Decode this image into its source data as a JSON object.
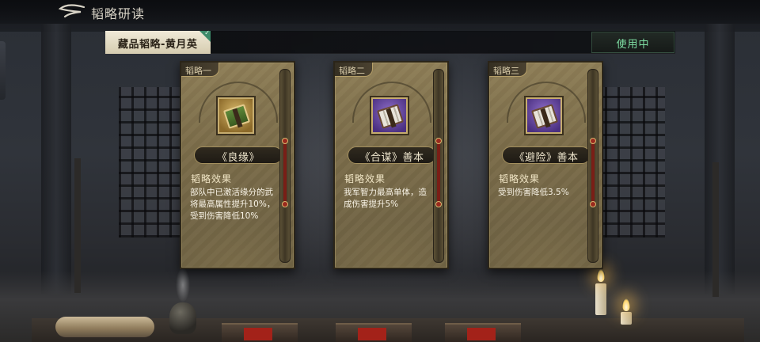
{
  "header": {
    "title": "韬略研读",
    "back_icon": "back-arrow-icon"
  },
  "strip": {
    "collection_label": "藏品韬略-黄月英",
    "status_label": "使用中",
    "status_color": "#7fe0a4"
  },
  "cards": [
    {
      "tag": "韬略一",
      "name": "《良缘》",
      "icon": "green-book-icon",
      "frame_color": "gold",
      "effect_heading": "韬略效果",
      "effect_text": "部队中已激活缘分的武将最高属性提升10%，受到伤害降低10%"
    },
    {
      "tag": "韬略二",
      "name": "《合谋》善本",
      "icon": "scroll-book-icon",
      "frame_color": "purple",
      "effect_heading": "韬略效果",
      "effect_text": "我军智力最高单体，造成伤害提升5%"
    },
    {
      "tag": "韬略三",
      "name": "《避险》善本",
      "icon": "scroll-book-icon",
      "frame_color": "purple",
      "effect_heading": "韬略效果",
      "effect_text": "受到伤害降低3.5%"
    }
  ]
}
